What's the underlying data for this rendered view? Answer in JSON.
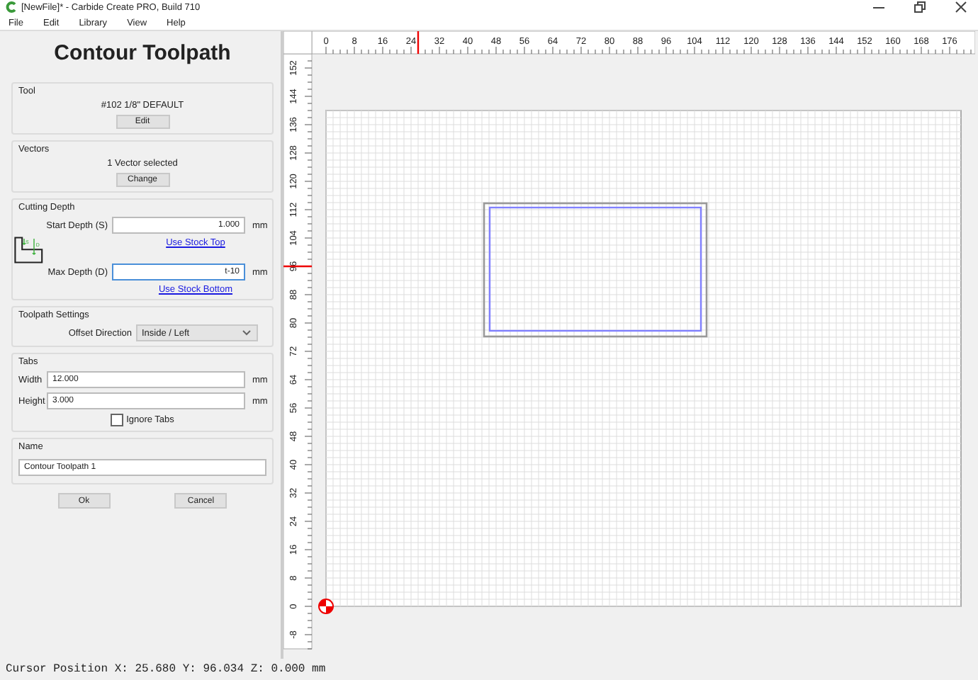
{
  "window": {
    "title": "[NewFile]* - Carbide Create PRO, Build 710"
  },
  "menu": [
    "File",
    "Edit",
    "Library",
    "View",
    "Help"
  ],
  "panel": {
    "title": "Contour Toolpath",
    "tool": {
      "label": "Tool",
      "name": "#102 1/8\" DEFAULT",
      "button": "Edit"
    },
    "vectors": {
      "label": "Vectors",
      "summary": "1 Vector selected",
      "button": "Change"
    },
    "cutting_depth": {
      "label": "Cutting Depth",
      "start_label": "Start Depth (S)",
      "start_value": "1.000",
      "start_unit": "mm",
      "start_link": "Use Stock Top",
      "max_label": "Max Depth (D)",
      "max_value": "t-10",
      "max_unit": "mm",
      "max_link": "Use Stock Bottom",
      "diagram_s": "S",
      "diagram_d": "D"
    },
    "toolpath_settings": {
      "label": "Toolpath Settings",
      "offset_label": "Offset Direction",
      "offset_value": "Inside / Left"
    },
    "tabs": {
      "label": "Tabs",
      "width_label": "Width",
      "width_value": "12.000",
      "width_unit": "mm",
      "height_label": "Height",
      "height_value": "3.000",
      "height_unit": "mm",
      "ignore_label": "Ignore Tabs",
      "ignore_checked": false
    },
    "name": {
      "label": "Name",
      "value": "Contour Toolpath 1"
    },
    "buttons": [
      "Ok",
      "Cancel"
    ]
  },
  "top_ruler": [
    "0",
    "8",
    "16",
    "24",
    "32",
    "40",
    "48",
    "56",
    "64",
    "72",
    "80",
    "88",
    "96",
    "104",
    "112",
    "120",
    "128",
    "136",
    "144",
    "152",
    "160",
    "168",
    "176"
  ],
  "left_ruler": [
    "152",
    "144",
    "136",
    "128",
    "120",
    "112",
    "104",
    "96",
    "88",
    "80",
    "72",
    "64",
    "56",
    "48",
    "40",
    "32",
    "24",
    "16",
    "8",
    "0",
    "-8"
  ],
  "status_bar": "Cursor Position X: 25.680 Y: 96.034 Z: 0.000 mm"
}
